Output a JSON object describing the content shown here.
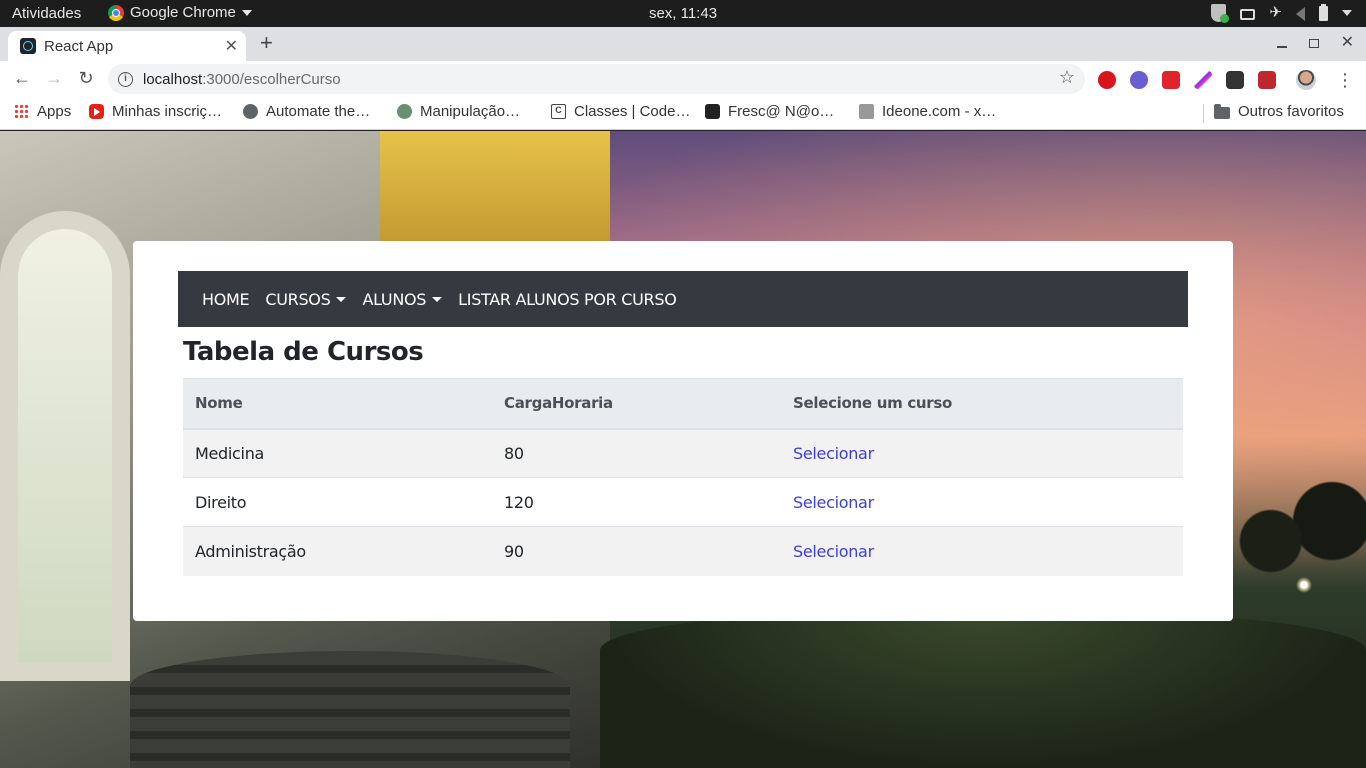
{
  "os_bar": {
    "activities": "Atividades",
    "app_name": "Google Chrome",
    "clock": "sex, 11:43"
  },
  "browser": {
    "tab_title": "React App",
    "url_host": "localhost",
    "url_path": ":3000/escolherCurso",
    "bookmarks": [
      {
        "label": "Apps",
        "icon": "apps-grid-icon"
      },
      {
        "label": "Minhas inscriç…",
        "icon": "youtube-icon"
      },
      {
        "label": "Automate the…",
        "icon": "globe-icon"
      },
      {
        "label": "Manipulação…",
        "icon": "site-icon"
      },
      {
        "label": "Classes | Code…",
        "icon": "code-icon"
      },
      {
        "label": "Fresc@ N@o…",
        "icon": "site-icon"
      },
      {
        "label": "Ideone.com - x…",
        "icon": "ideone-icon"
      }
    ],
    "other_bookmarks": "Outros favoritos"
  },
  "app": {
    "nav": {
      "home": "HOME",
      "cursos": "CURSOS",
      "alunos": "ALUNOS",
      "listar": "LISTAR ALUNOS POR CURSO"
    },
    "title": "Tabela de Cursos",
    "table": {
      "headers": [
        "Nome",
        "CargaHoraria",
        "Selecione um curso"
      ],
      "rows": [
        {
          "nome": "Medicina",
          "carga": "80",
          "acao": "Selecionar"
        },
        {
          "nome": "Direito",
          "carga": "120",
          "acao": "Selecionar"
        },
        {
          "nome": "Administração",
          "carga": "90",
          "acao": "Selecionar"
        }
      ]
    }
  },
  "colors": {
    "navbar_bg": "#343a40",
    "link": "#3b3fd6",
    "header_bg": "#e9ecef"
  }
}
